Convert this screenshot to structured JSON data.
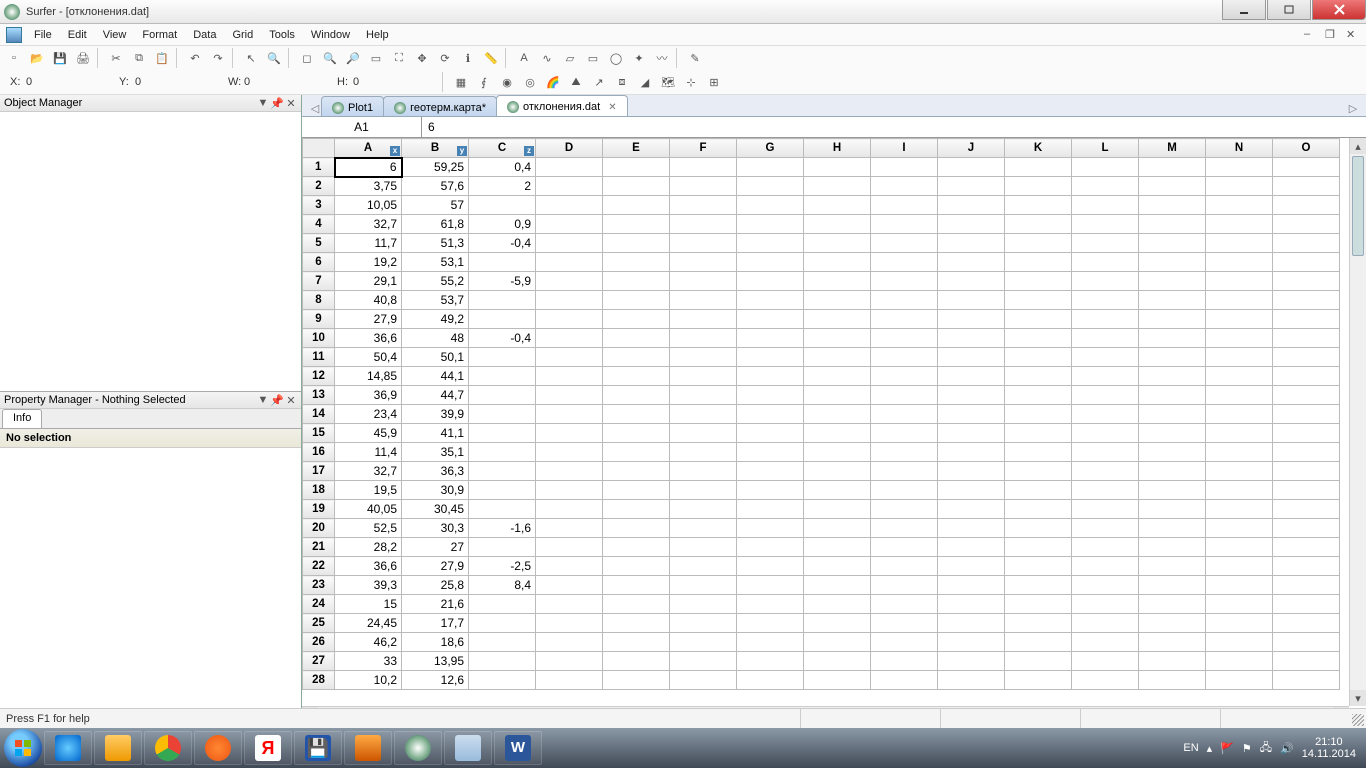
{
  "title": "Surfer - [отклонения.dat]",
  "menu": [
    "File",
    "Edit",
    "View",
    "Format",
    "Data",
    "Grid",
    "Tools",
    "Window",
    "Help"
  ],
  "coords": {
    "x_label": "X:",
    "x": "0",
    "y_label": "Y:",
    "y": "0",
    "w_label": "W:",
    "w": "0",
    "h_label": "H:",
    "h": "0"
  },
  "panels": {
    "object_manager": "Object Manager",
    "property_manager": "Property Manager - Nothing Selected",
    "info_tab": "Info",
    "no_selection": "No selection"
  },
  "tabs": [
    {
      "label": "Plot1",
      "active": false,
      "closable": false
    },
    {
      "label": "геотерм.карта*",
      "active": false,
      "closable": false
    },
    {
      "label": "отклонения.dat",
      "active": true,
      "closable": true
    }
  ],
  "cellref": {
    "addr": "A1",
    "val": "6"
  },
  "columns": [
    "A",
    "B",
    "C",
    "D",
    "E",
    "F",
    "G",
    "H",
    "I",
    "J",
    "K",
    "L",
    "M",
    "N",
    "O"
  ],
  "axis_tags": {
    "A": "x",
    "B": "y",
    "C": "z"
  },
  "rows": [
    {
      "n": 1,
      "A": "6",
      "B": "59,25",
      "C": "0,4"
    },
    {
      "n": 2,
      "A": "3,75",
      "B": "57,6",
      "C": "2"
    },
    {
      "n": 3,
      "A": "10,05",
      "B": "57",
      "C": ""
    },
    {
      "n": 4,
      "A": "32,7",
      "B": "61,8",
      "C": "0,9"
    },
    {
      "n": 5,
      "A": "11,7",
      "B": "51,3",
      "C": "-0,4"
    },
    {
      "n": 6,
      "A": "19,2",
      "B": "53,1",
      "C": ""
    },
    {
      "n": 7,
      "A": "29,1",
      "B": "55,2",
      "C": "-5,9"
    },
    {
      "n": 8,
      "A": "40,8",
      "B": "53,7",
      "C": ""
    },
    {
      "n": 9,
      "A": "27,9",
      "B": "49,2",
      "C": ""
    },
    {
      "n": 10,
      "A": "36,6",
      "B": "48",
      "C": "-0,4"
    },
    {
      "n": 11,
      "A": "50,4",
      "B": "50,1",
      "C": ""
    },
    {
      "n": 12,
      "A": "14,85",
      "B": "44,1",
      "C": ""
    },
    {
      "n": 13,
      "A": "36,9",
      "B": "44,7",
      "C": ""
    },
    {
      "n": 14,
      "A": "23,4",
      "B": "39,9",
      "C": ""
    },
    {
      "n": 15,
      "A": "45,9",
      "B": "41,1",
      "C": ""
    },
    {
      "n": 16,
      "A": "11,4",
      "B": "35,1",
      "C": ""
    },
    {
      "n": 17,
      "A": "32,7",
      "B": "36,3",
      "C": ""
    },
    {
      "n": 18,
      "A": "19,5",
      "B": "30,9",
      "C": ""
    },
    {
      "n": 19,
      "A": "40,05",
      "B": "30,45",
      "C": ""
    },
    {
      "n": 20,
      "A": "52,5",
      "B": "30,3",
      "C": "-1,6"
    },
    {
      "n": 21,
      "A": "28,2",
      "B": "27",
      "C": ""
    },
    {
      "n": 22,
      "A": "36,6",
      "B": "27,9",
      "C": "-2,5"
    },
    {
      "n": 23,
      "A": "39,3",
      "B": "25,8",
      "C": "8,4"
    },
    {
      "n": 24,
      "A": "15",
      "B": "21,6",
      "C": ""
    },
    {
      "n": 25,
      "A": "24,45",
      "B": "17,7",
      "C": ""
    },
    {
      "n": 26,
      "A": "46,2",
      "B": "18,6",
      "C": ""
    },
    {
      "n": 27,
      "A": "33",
      "B": "13,95",
      "C": ""
    },
    {
      "n": 28,
      "A": "10,2",
      "B": "12,6",
      "C": ""
    }
  ],
  "status": "Press F1 for help",
  "tray": {
    "lang": "EN",
    "time": "21:10",
    "date": "14.11.2014"
  }
}
